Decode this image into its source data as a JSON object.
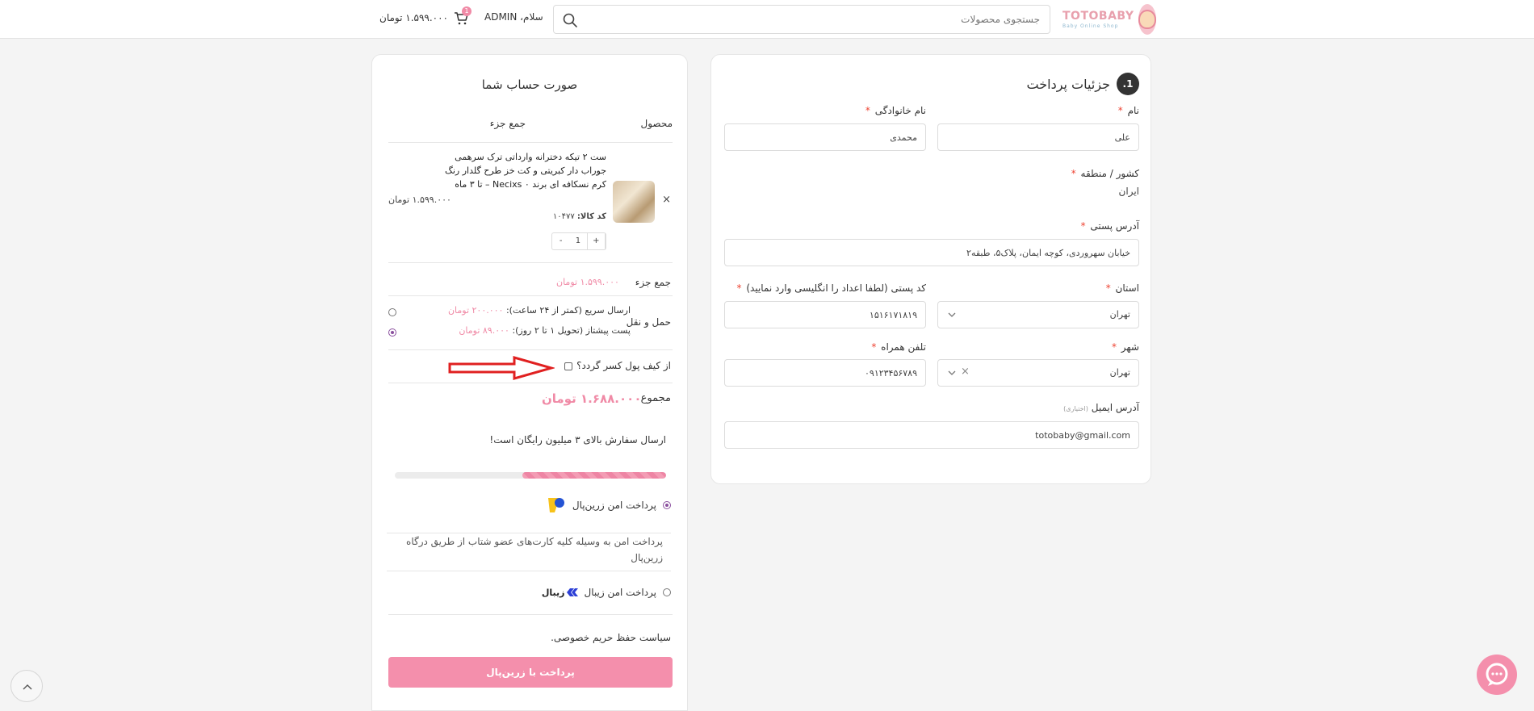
{
  "header": {
    "logo_text": "TOTOBABY",
    "logo_sub": "Baby Online Shop",
    "search_placeholder": "جستجوی محصولات",
    "greeting": "سلام، ADMIN",
    "cart_total": "۱.۵۹۹.۰۰۰ تومان",
    "cart_count": "1"
  },
  "billing": {
    "step_number": "1.",
    "title": "جزئیات پرداخت",
    "first_name_label": "نام",
    "first_name_value": "علی",
    "last_name_label": "نام خانوادگی",
    "last_name_value": "محمدی",
    "country_label": "کشور / منطقه",
    "country_value": "ایران",
    "address_label": "آدرس پستی",
    "address_value": "خیابان سهروردی، کوچه ایمان، پلاک۵، طبقه۲",
    "state_label": "استان",
    "state_value": "تهران",
    "postcode_label": "کد پستی (لطفا اعداد را انگلیسی وارد نمایید)",
    "postcode_value": "۱۵۱۶۱۷۱۸۱۹",
    "city_label": "شهر",
    "city_value": "تهران",
    "phone_label": "تلفن همراه",
    "phone_value": "۰۹۱۲۳۴۵۶۷۸۹",
    "email_label": "آدرس ایمیل",
    "email_optional": "(اختیاری)",
    "email_value": "totobaby@gmail.com",
    "required_mark": "*"
  },
  "summary": {
    "title": "صورت حساب شما",
    "col_product": "محصول",
    "col_subtotal": "جمع جزء",
    "product_title": "ست ۲ تیکه دخترانه وارداتی ترک سرهمی جوراب دار کبریتی و کت خز طرح گلدار رنگ کرم نسکافه ای برند Necixs ۰ – تا ۳ ماه",
    "remove": "×",
    "sku_label": "کد کالا:",
    "sku_value": "۱۰۴۷۷",
    "qty_minus": "-",
    "qty_value": "1",
    "qty_plus": "+",
    "product_price": "۱.۵۹۹.۰۰۰ تومان",
    "subtotal_label": "جمع جزء",
    "subtotal_value": "۱.۵۹۹.۰۰۰ تومان",
    "shipping_label": "حمل و نقل",
    "ship_express_label": "ارسال سریع (کمتر از ۲۴ ساعت):",
    "ship_express_price": "۲۰۰.۰۰۰ تومان",
    "ship_post_label": "پست پیشتاز (تحویل ۱ تا ۲ روز):",
    "ship_post_price": "۸۹.۰۰۰ تومان",
    "wallet_label": "از کیف پول کسر گردد؟",
    "total_label": "مجموع",
    "total_value": "۱.۶۸۸.۰۰۰ تومان",
    "free_shipping_note": "ارسال سفارش بالای ۳ میلیون رایگان است!",
    "progress_fraction": 0.53,
    "pay_zarinpal_label": "پرداخت امن زرین‌پال",
    "pay_zarinpal_desc": "پرداخت امن به وسیله کلیه کارت‌های عضو شتاب از طریق درگاه زرین‌پال",
    "pay_zibal_label": "پرداخت امن زیبال",
    "zibal_logo_text": "زیبال",
    "privacy_text": "سیاست حفظ حریم خصوصی.",
    "pay_button": "پرداخت با زرین‌پال"
  },
  "colors": {
    "accent_pink": "#f08aa6",
    "button_pink": "#f48fac",
    "radio_purple": "#8a4f9e",
    "annotation_red": "#e02020"
  }
}
